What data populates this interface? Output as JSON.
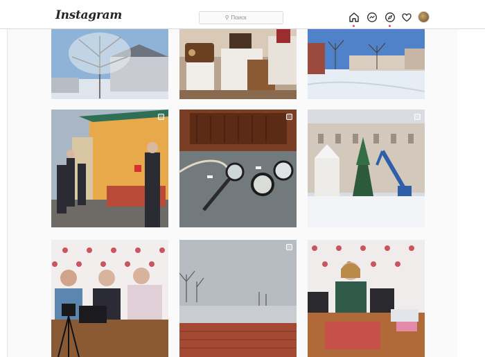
{
  "app": {
    "logo_text": "Instagram"
  },
  "search": {
    "placeholder": "Поиск",
    "icon": "search-icon"
  },
  "nav": {
    "icons": [
      "home-icon",
      "messenger-icon",
      "explore-icon",
      "heart-icon",
      "avatar"
    ],
    "accent_color": "#ed4956"
  },
  "grid": {
    "rows": [
      [
        "post-tree-snow",
        "post-museum-radios",
        "post-snowy-courtyard"
      ],
      [
        "post-people-yellow-building",
        "post-magnifier-compass",
        "post-christmas-tree-crane"
      ],
      [
        "post-women-at-table",
        "post-foggy-field",
        "post-woman-laptop"
      ]
    ]
  }
}
